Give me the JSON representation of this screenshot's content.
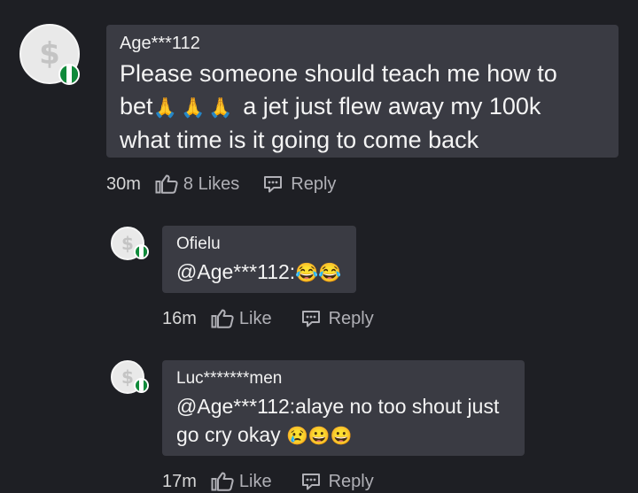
{
  "comments": [
    {
      "username": "Age***112",
      "message_line1": "Please someone should teach me how to",
      "message_line2_a": "bet",
      "message_line2_emoji": "🙏🙏🙏",
      "message_line2_b": "a jet just flew away my 100k",
      "message_line3": "what time is it going to come back",
      "time": "30m",
      "likes": "8 Likes",
      "reply": "Reply",
      "avatar_icon": "dollar-coin-avatar",
      "flag_icon": "nigeria-flag-icon"
    },
    {
      "username": "Ofielu",
      "message": "@Age***112:",
      "message_emoji": "😂😂",
      "time": "16m",
      "likes": "Like",
      "reply": "Reply",
      "avatar_icon": "dollar-coin-avatar",
      "flag_icon": "nigeria-flag-icon"
    },
    {
      "username": "Luc*******men",
      "message_line1": "@Age***112:alaye no too shout just",
      "message_line2": "go cry okay",
      "message_line2_emoji": "😢😀😀",
      "time": "17m",
      "likes": "Like",
      "reply": "Reply",
      "avatar_icon": "dollar-coin-avatar",
      "flag_icon": "nigeria-flag-icon"
    }
  ],
  "colors": {
    "background": "#1e1f24",
    "bubble": "#3a3b43",
    "meta_text": "#b0b0b6",
    "flag_green": "#0f8a3a"
  }
}
